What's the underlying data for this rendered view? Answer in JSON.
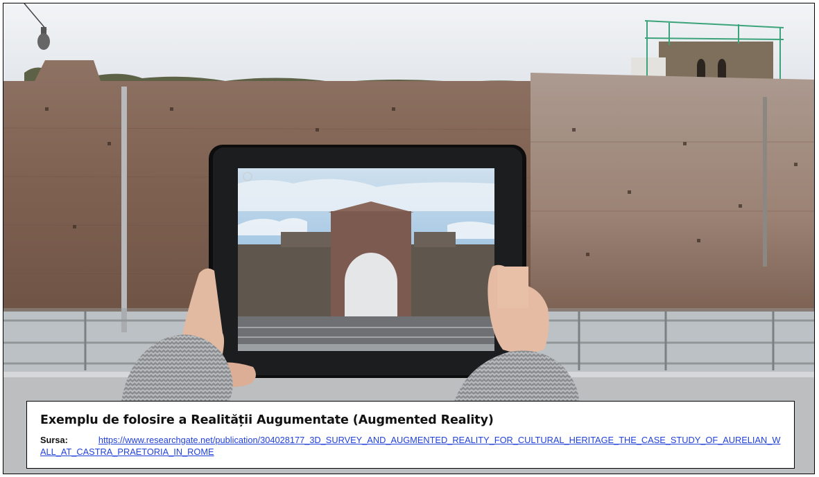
{
  "caption": {
    "title": "Exemplu de folosire a Realității Augumentate (Augmented Reality)",
    "source_label": "Sursa:",
    "source_link": "https://www.researchgate.net/publication/304028177_3D_SURVEY_AND_AUGMENTED_REALITY_FOR_CULTURAL_HERITAGE_THE_CASE_STUDY_OF_AURELIAN_WALL_AT_CASTRA_PRAETORIA_IN_ROME"
  },
  "colors": {
    "sky": "#e9edf1",
    "wall_brick": "#8a6b59",
    "wall_light": "#a89488",
    "tablet_bezel": "#0d0d0e",
    "ar_sky": "#a9cbe4",
    "ar_arch": "#7d5a4f",
    "sweater": "#9c9fa2",
    "link": "#1f3fdc"
  },
  "icons": [
    "tablet-icon",
    "hands-icon"
  ]
}
